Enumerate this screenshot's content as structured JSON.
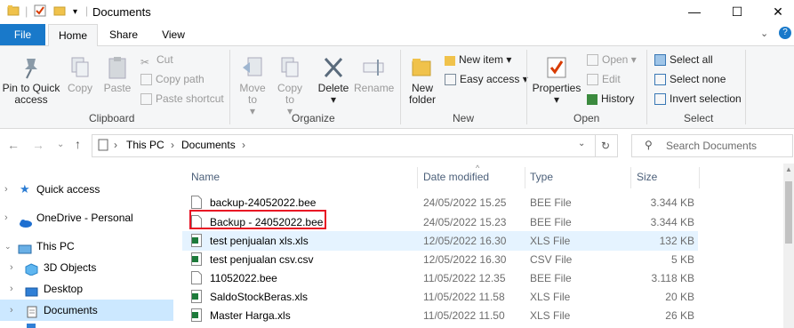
{
  "window": {
    "title": "Documents",
    "minimize": "—",
    "maximize": "☐",
    "close": "✕",
    "help": "?"
  },
  "tabs": [
    "File",
    "Home",
    "Share",
    "View"
  ],
  "ribbon": {
    "clipboard": {
      "pin": "Pin to Quick access",
      "copy": "Copy",
      "paste": "Paste",
      "cut": "Cut",
      "copy_path": "Copy path",
      "paste_shortcut": "Paste shortcut",
      "label": "Clipboard"
    },
    "organize": {
      "move_to": "Move to",
      "copy_to": "Copy to",
      "delete": "Delete",
      "rename": "Rename",
      "label": "Organize"
    },
    "new": {
      "new_folder": "New folder",
      "new_item": "New item",
      "easy_access": "Easy access",
      "label": "New"
    },
    "open": {
      "properties": "Properties",
      "open": "Open",
      "edit": "Edit",
      "history": "History",
      "label": "Open"
    },
    "select": {
      "select_all": "Select all",
      "select_none": "Select none",
      "invert": "Invert selection",
      "label": "Select"
    }
  },
  "address": {
    "crumbs": [
      "This PC",
      "Documents"
    ],
    "search_placeholder": "Search Documents"
  },
  "nav": [
    {
      "label": "Quick access"
    },
    {
      "label": "OneDrive - Personal"
    },
    {
      "label": "This PC"
    },
    {
      "label": "3D Objects"
    },
    {
      "label": "Desktop"
    },
    {
      "label": "Documents"
    }
  ],
  "columns": {
    "name": "Name",
    "date": "Date modified",
    "type": "Type",
    "size": "Size"
  },
  "files": [
    {
      "name": "backup-24052022.bee",
      "date": "24/05/2022 15.25",
      "type": "BEE File",
      "size": "3.344 KB",
      "icon": "blank-file-icon"
    },
    {
      "name": "Backup - 24052022.bee",
      "date": "24/05/2022 15.23",
      "type": "BEE File",
      "size": "3.344 KB",
      "icon": "blank-file-icon"
    },
    {
      "name": "test penjualan xls.xls",
      "date": "12/05/2022 16.30",
      "type": "XLS File",
      "size": "132 KB",
      "icon": "excel-file-icon"
    },
    {
      "name": "test penjualan csv.csv",
      "date": "12/05/2022 16.30",
      "type": "CSV File",
      "size": "5 KB",
      "icon": "excel-file-icon"
    },
    {
      "name": "11052022.bee",
      "date": "11/05/2022 12.35",
      "type": "BEE File",
      "size": "3.118 KB",
      "icon": "blank-file-icon"
    },
    {
      "name": "SaldoStockBeras.xls",
      "date": "11/05/2022 11.58",
      "type": "XLS File",
      "size": "20 KB",
      "icon": "excel-file-icon"
    },
    {
      "name": "Master Harga.xls",
      "date": "11/05/2022 11.50",
      "type": "XLS File",
      "size": "26 KB",
      "icon": "excel-file-icon"
    }
  ],
  "colors": {
    "accent": "#1979ca",
    "highlight": "#e5f3ff",
    "selected_nav": "#cce8ff",
    "red_box": "#e81123"
  }
}
